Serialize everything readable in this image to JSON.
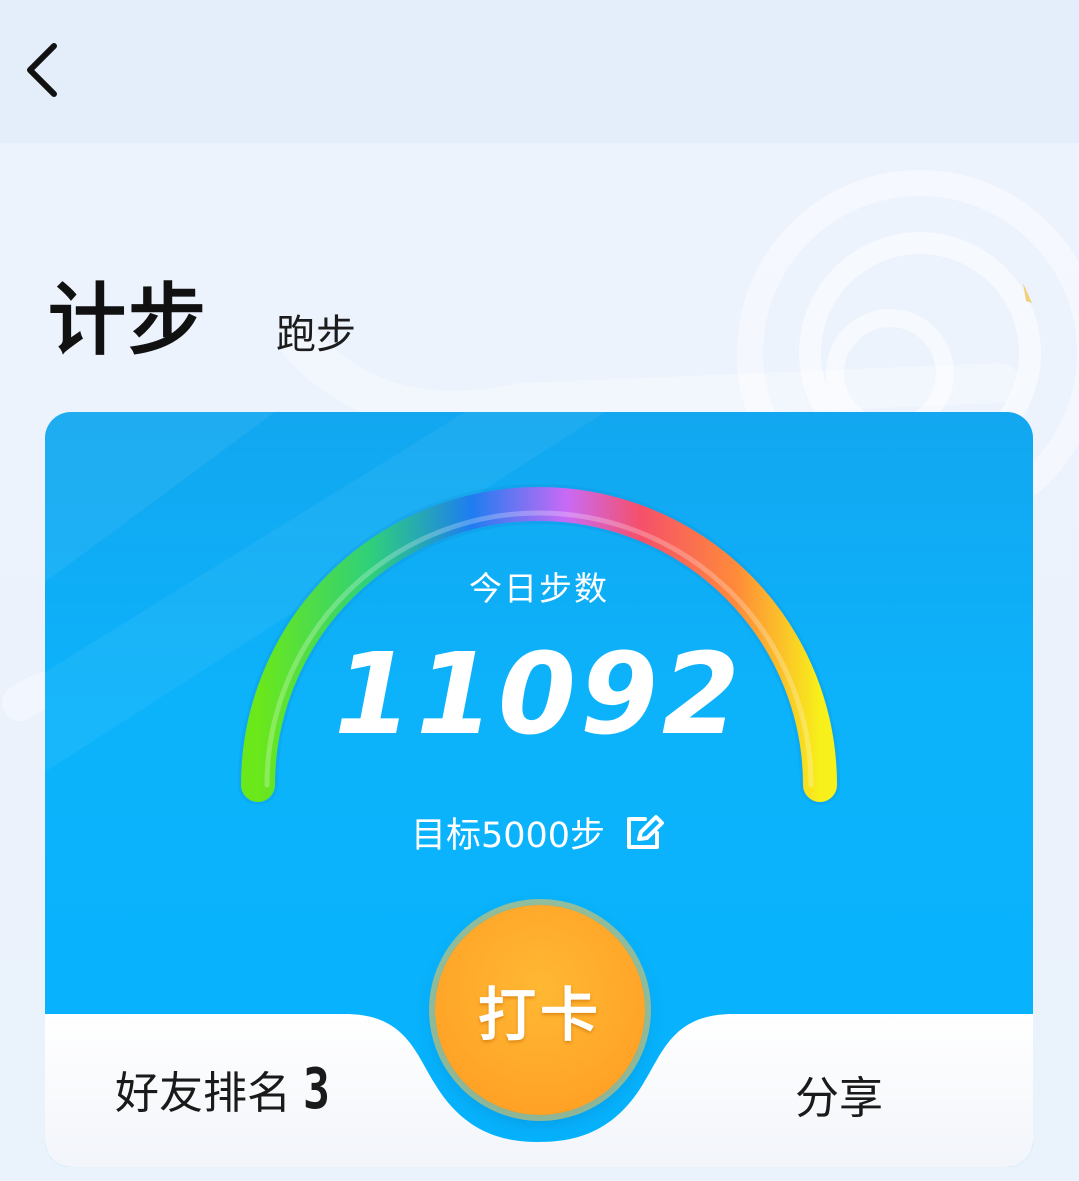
{
  "header": {
    "back_icon": "chevron-left-icon"
  },
  "tabs": {
    "active": "计步",
    "inactive": "跑步"
  },
  "card": {
    "today_label": "今日步数",
    "steps": "11092",
    "goal_text": "目标5000步",
    "edit_icon": "edit-icon",
    "checkin_label": "打卡",
    "ranking_label": "好友排名",
    "ranking_value": "3",
    "share_label": "分享"
  },
  "colors": {
    "card_blue": "#06b2fc",
    "checkin_orange": "#ffa82a",
    "page_bg": "#e9f1fc"
  }
}
